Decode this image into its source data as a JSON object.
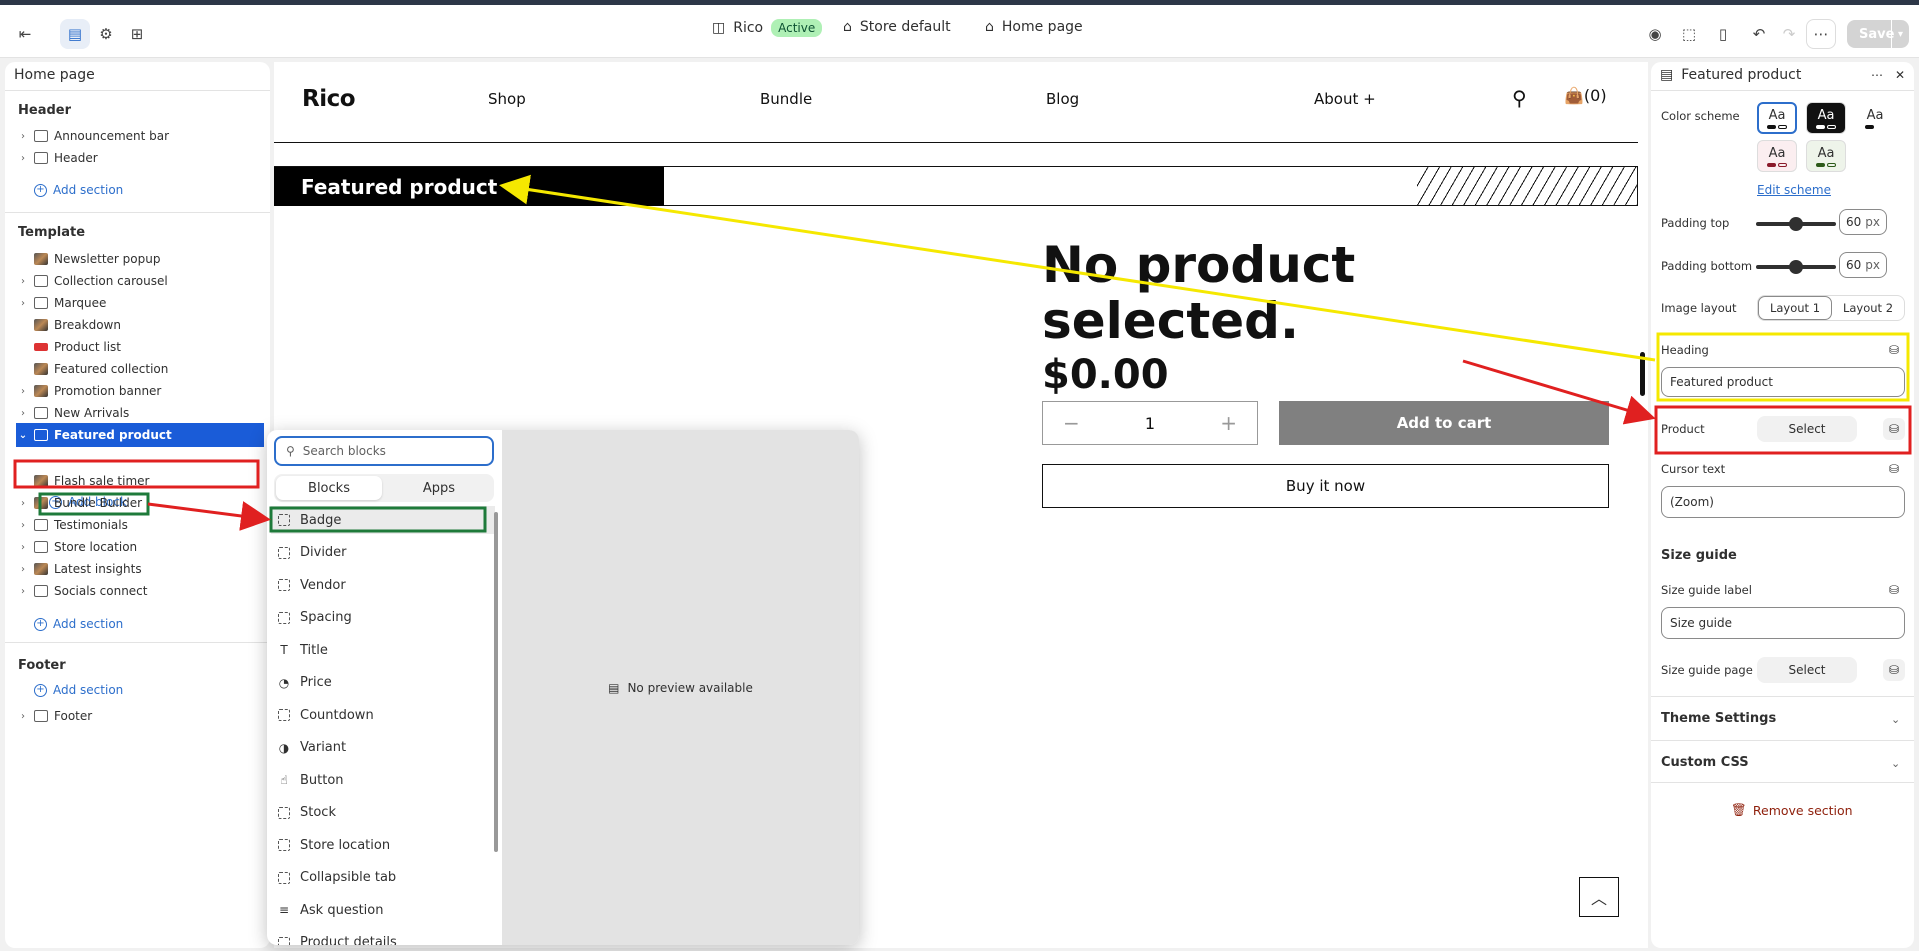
{
  "topbar": {
    "theme_name": "Rico",
    "theme_status": "Active",
    "store": "Store default",
    "page": "Home page",
    "save_label": "Save"
  },
  "left": {
    "title": "Home page",
    "header_group": "Header",
    "header_items": [
      "Announcement bar",
      "Header"
    ],
    "add_section": "Add section",
    "template_group": "Template",
    "template_items": [
      "Newsletter popup",
      "Collection carousel",
      "Marquee",
      "Breakdown",
      "Product list",
      "Featured collection",
      "Promotion banner",
      "New Arrivals",
      "Featured product"
    ],
    "add_block": "Add block",
    "template_items_after": [
      "Flash sale timer",
      "Bundle Builder",
      "Testimonials",
      "Store location",
      "Latest insights",
      "Socials connect"
    ],
    "footer_group": "Footer",
    "footer_items": [
      "Footer"
    ]
  },
  "preview": {
    "logo": "Rico",
    "nav": [
      "Shop",
      "Bundle",
      "Blog",
      "About +"
    ],
    "cart": "(0)",
    "banner": "Featured product",
    "no_product": "No product selected.",
    "price": "$0.00",
    "qty": "1",
    "add_to_cart": "Add to cart",
    "buy_now": "Buy it now"
  },
  "picker": {
    "search_placeholder": "Search blocks",
    "tabs": [
      "Blocks",
      "Apps"
    ],
    "items": [
      "Badge",
      "Divider",
      "Vendor",
      "Spacing",
      "Title",
      "Price",
      "Countdown",
      "Variant",
      "Button",
      "Stock",
      "Store location",
      "Collapsible tab",
      "Ask question",
      "Product details"
    ],
    "no_preview": "No preview available"
  },
  "right": {
    "title": "Featured product",
    "color_scheme": "Color scheme",
    "swatch_text": "Aa",
    "edit_scheme": "Edit scheme",
    "padding_top": "Padding top",
    "padding_top_value": "60",
    "padding_top_level": 0.5,
    "padding_bottom": "Padding bottom",
    "padding_bottom_value": "60",
    "padding_bottom_level": 0.5,
    "unit": "px",
    "image_layout": "Image layout",
    "layouts": [
      "Layout 1",
      "Layout 2"
    ],
    "heading": "Heading",
    "heading_value": "Featured product",
    "product": "Product",
    "select": "Select",
    "cursor_text": "Cursor text",
    "cursor_value": "(Zoom)",
    "size_guide": "Size guide",
    "size_guide_label": "Size guide label",
    "size_guide_label_value": "Size guide",
    "size_guide_page": "Size guide page",
    "theme_settings": "Theme Settings",
    "custom_css": "Custom CSS",
    "remove_section": "Remove section"
  },
  "colors": {
    "accent": "#2c6ecb",
    "active_item": "#1a5cd8",
    "annot_red": "#e02020",
    "annot_yellow": "#f5e800",
    "annot_green": "#1e7a3a"
  }
}
